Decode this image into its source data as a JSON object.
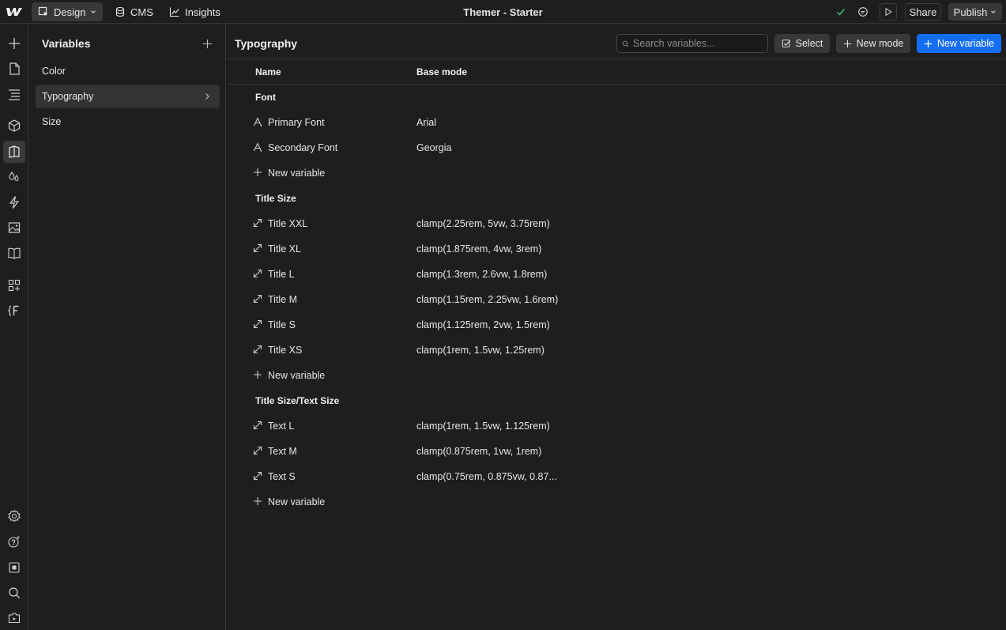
{
  "app": {
    "title": "Themer - Starter",
    "tabs": [
      {
        "label": "Design",
        "icon": "design-cursor-icon"
      },
      {
        "label": "CMS",
        "icon": "database-icon"
      },
      {
        "label": "Insights",
        "icon": "chart-line-icon"
      }
    ],
    "share_label": "Share",
    "publish_label": "Publish",
    "accent_color": "#146ef5"
  },
  "rail": {
    "top_icons": [
      "plus-icon",
      "page-icon",
      "navigator-icon",
      "components-icon",
      "variables-icon",
      "styles-icon",
      "interactions-icon",
      "assets-icon",
      "library-icon",
      "apps-icon",
      "finsweet-icon"
    ],
    "bottom_icons": [
      "settings-icon",
      "help-icon",
      "stop-icon",
      "search-icon",
      "video-icon"
    ]
  },
  "variables_panel": {
    "title": "Variables",
    "collections": [
      "Color",
      "Typography",
      "Size"
    ],
    "selected": "Typography"
  },
  "main": {
    "title": "Typography",
    "search_placeholder": "Search variables...",
    "select_label": "Select",
    "new_mode_label": "New mode",
    "new_variable_label": "New variable",
    "columns": {
      "name": "Name",
      "base_mode": "Base mode"
    },
    "groups": [
      {
        "label": "Font",
        "icon": "font-icon",
        "variables": [
          {
            "name": "Primary Font",
            "value": "Arial"
          },
          {
            "name": "Secondary Font",
            "value": "Georgia"
          }
        ],
        "add_label": "New variable"
      },
      {
        "label": "Title Size",
        "icon": "size-arrow-icon",
        "variables": [
          {
            "name": "Title XXL",
            "value": "clamp(2.25rem, 5vw, 3.75rem)"
          },
          {
            "name": "Title XL",
            "value": "clamp(1.875rem, 4vw, 3rem)"
          },
          {
            "name": "Title L",
            "value": "clamp(1.3rem, 2.6vw, 1.8rem)"
          },
          {
            "name": "Title M",
            "value": "clamp(1.15rem, 2.25vw, 1.6rem)"
          },
          {
            "name": "Title S",
            "value": "clamp(1.125rem, 2vw, 1.5rem)"
          },
          {
            "name": "Title XS",
            "value": "clamp(1rem, 1.5vw, 1.25rem)"
          }
        ],
        "add_label": "New variable"
      },
      {
        "label": "Title Size/Text Size",
        "icon": "size-arrow-icon",
        "variables": [
          {
            "name": "Text L",
            "value": "clamp(1rem, 1.5vw, 1.125rem)"
          },
          {
            "name": "Text M",
            "value": "clamp(0.875rem, 1vw, 1rem)"
          },
          {
            "name": "Text S",
            "value": "clamp(0.75rem, 0.875vw, 0.87..."
          }
        ],
        "add_label": "New variable"
      }
    ]
  }
}
